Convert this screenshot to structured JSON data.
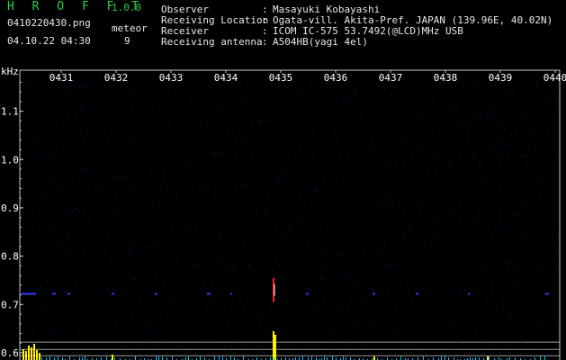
{
  "header": {
    "app_name": "H R O F F T",
    "version": "1.0.0",
    "filename": "0410220430.png",
    "timestamp": "04.10.22 04:30",
    "meteor_label": "meteor",
    "meteor_count": "9",
    "info": [
      {
        "key": "Observer",
        "sep": ":",
        "value": "Masayuki Kobayashi"
      },
      {
        "key": "Receiving Location",
        "sep": ":",
        "value": "Ogata-vill. Akita-Pref. JAPAN (139.96E, 40.02N)"
      },
      {
        "key": "Receiver",
        "sep": ":",
        "value": "ICOM IC-575 53.7492(@LCD)MHz USB"
      },
      {
        "key": "Receiving antenna",
        "sep": ":",
        "value": "A504HB(yagi 4el)"
      }
    ]
  },
  "chart_data": {
    "type": "heatmap",
    "ylabel": "kHz",
    "x_ticks": [
      "0431",
      "0432",
      "0433",
      "0434",
      "0435",
      "0436",
      "0437",
      "0438",
      "0439",
      "0440"
    ],
    "y_ticks": [
      1.1,
      1.0,
      0.9,
      0.8,
      0.7,
      0.6
    ],
    "ylim": [
      0.585,
      1.185
    ],
    "colors": {
      "axis": "#c8c8c8",
      "noise": "#1a1a8a",
      "signal": "#2a3cff",
      "echo_red": "#ff2020",
      "echo_white": "#ffffff",
      "bars_yellow": "#ffee00",
      "bars_cyan": "#00c8ff",
      "ref_lines": "#9a9a9a"
    }
  }
}
